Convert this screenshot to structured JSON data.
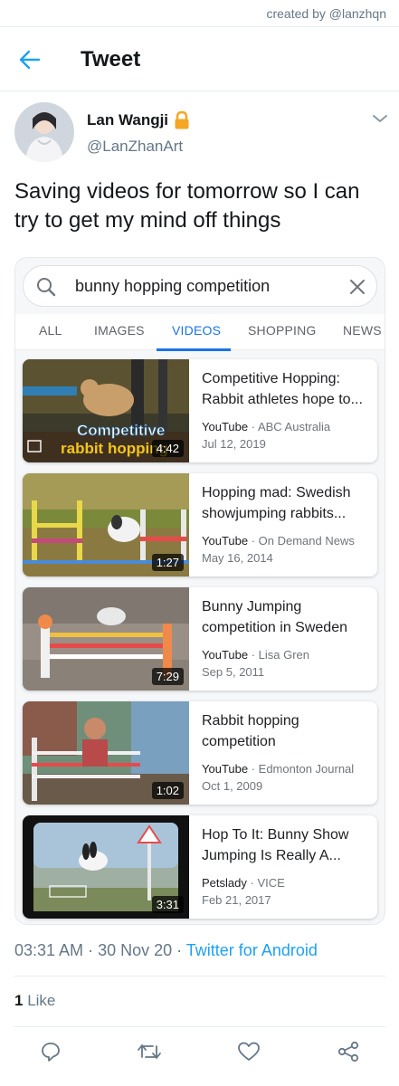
{
  "credit": "created by @lanzhqn",
  "header": {
    "title": "Tweet",
    "back_icon": "arrow-left-icon"
  },
  "author": {
    "display_name": "Lan Wangji",
    "handle": "@LanZhanArt",
    "protected_icon": "lock-icon",
    "menu_icon": "chevron-down-icon"
  },
  "tweet": {
    "text": "Saving videos for tomorrow so I can try to get my mind off things"
  },
  "embed": {
    "search": {
      "query": "bunny hopping competition",
      "search_icon": "search-icon",
      "clear_icon": "close-icon"
    },
    "tabs": [
      "ALL",
      "IMAGES",
      "VIDEOS",
      "SHOPPING",
      "NEWS"
    ],
    "active_tab": "VIDEOS",
    "results": [
      {
        "title": "Competitive Hopping: Rabbit athletes hope to...",
        "source": "YouTube",
        "channel": "ABC Australia",
        "date": "Jul 12, 2019",
        "duration": "4:42",
        "overlay_line1": "Competitive",
        "overlay_line2": "rabbit hopping"
      },
      {
        "title": "Hopping mad: Swedish showjumping rabbits...",
        "source": "YouTube",
        "channel": "On Demand News",
        "date": "May 16, 2014",
        "duration": "1:27"
      },
      {
        "title": "Bunny Jumping competition in Sweden",
        "source": "YouTube",
        "channel": "Lisa Gren",
        "date": "Sep 5, 2011",
        "duration": "7:29"
      },
      {
        "title": "Rabbit hopping competition",
        "source": "YouTube",
        "channel": "Edmonton Journal",
        "date": "Oct 1, 2009",
        "duration": "1:02"
      },
      {
        "title": "Hop To It: Bunny Show Jumping Is Really A...",
        "source": "Petslady",
        "channel": "VICE",
        "date": "Feb 21, 2017",
        "duration": "3:31"
      }
    ]
  },
  "meta": {
    "time": "03:31 AM",
    "date": "30 Nov 20",
    "client": "Twitter for Android",
    "separator": " · "
  },
  "engagement": {
    "like_count": "1",
    "like_label": "Like"
  },
  "actions": [
    "reply-icon",
    "retweet-icon",
    "like-icon",
    "share-icon"
  ],
  "colors": {
    "twitter_blue": "#1da1f2",
    "google_blue": "#1a73e8",
    "secondary_text": "#657786",
    "protected_lock": "#f5a623"
  }
}
